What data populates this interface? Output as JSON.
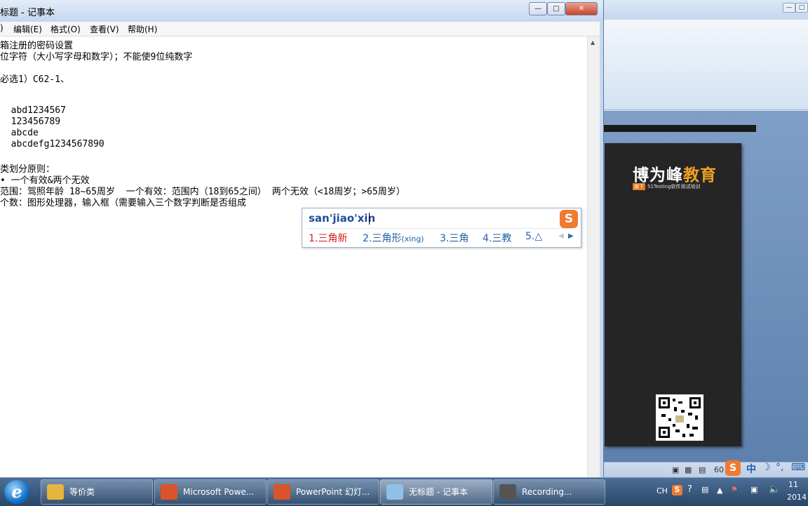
{
  "notepad": {
    "title": "无标题 - 记事本",
    "title_visible": "标题 - 记事本",
    "menus": [
      "文件(F)",
      "编辑(E)",
      "格式(O)",
      "查看(V)",
      "帮助(H)"
    ],
    "menus_visible": [
      ")",
      "编辑(E)",
      "格式(O)",
      "查看(V)",
      "帮助(H)"
    ],
    "lines": [
      "箱注册的密码设置",
      "位字符（大小写字母和数字）；不能使9位纯数字",
      "",
      "必选1）C62-1、",
      "",
      "",
      "  abd1234567",
      "  123456789",
      "  abcde",
      "  abcdefg1234567890",
      "",
      "类划分原则：",
      "• 一个有效&两个无效",
      "范围：驾照年龄 18~65周岁  一个有效：范围内（18到65之间） 两个无效（<18周岁；>65周岁）",
      "个数：图形处理器，输入框（需要输入三个数字判断是否组成"
    ]
  },
  "ime": {
    "input": "san'jiao'xin",
    "logo": "S",
    "candidates": [
      {
        "num": "1.",
        "text": "三角新",
        "suffix": ""
      },
      {
        "num": "2.",
        "text": "三角形",
        "suffix": "(xing)"
      },
      {
        "num": "3.",
        "text": "三角",
        "suffix": ""
      },
      {
        "num": "4.",
        "text": "三教",
        "suffix": ""
      },
      {
        "num": "5.",
        "text": "△",
        "suffix": ""
      }
    ]
  },
  "slide": {
    "brand_white": "博为峰",
    "brand_orange": "教育",
    "badge": "旗下",
    "subtitle": "51Testing软件测试培训"
  },
  "ppt_status": {
    "zoom": "60",
    "ime_mode": "中"
  },
  "taskbar": {
    "items": [
      {
        "label": "等价类",
        "color": "#e7b53d"
      },
      {
        "label": "Microsoft Powe...",
        "color": "#d8542a"
      },
      {
        "label": "PowerPoint 幻灯...",
        "color": "#d8542a"
      },
      {
        "label": "无标题 - 记事本",
        "color": "#8fc1e6"
      },
      {
        "label": "Recording...",
        "color": "#555555"
      }
    ],
    "tray": {
      "lang": "CH",
      "time": "11",
      "date": "2014"
    }
  }
}
